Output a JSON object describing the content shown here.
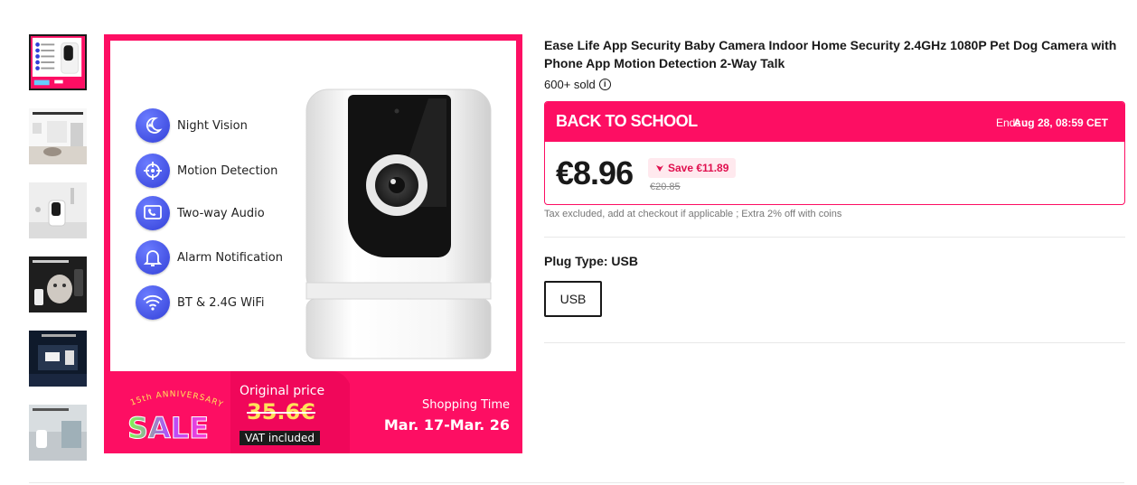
{
  "product": {
    "title": "Ease Life App Security Baby Camera Indoor Home Security 2.4GHz 1080P Pet Dog Camera with Phone App Motion Detection 2-Way Talk",
    "sold": "600+ sold",
    "info_icon": "info-icon"
  },
  "gallery": {
    "thumbnails": [
      {
        "name": "thumbnail-1",
        "active": true
      },
      {
        "name": "thumbnail-2",
        "active": false
      },
      {
        "name": "thumbnail-3",
        "active": false
      },
      {
        "name": "thumbnail-4",
        "active": false
      },
      {
        "name": "thumbnail-5",
        "active": false
      },
      {
        "name": "thumbnail-6",
        "active": false
      }
    ],
    "main_image": {
      "features": [
        {
          "label": "Night Vision",
          "icon": "moon-icon"
        },
        {
          "label": "Motion Detection",
          "icon": "motion-target-icon"
        },
        {
          "label": "Two-way Audio",
          "icon": "phone-call-icon"
        },
        {
          "label": "Alarm Notification",
          "icon": "bell-icon"
        },
        {
          "label": "BT & 2.4G WiFi",
          "icon": "wifi-icon"
        }
      ],
      "banner": {
        "anniversary": "15th ANNIVERSARY",
        "sale": "SALE",
        "original_price_label": "Original price",
        "original_price": "35.6€",
        "vat": "VAT included",
        "shopping_time_label": "Shopping Time",
        "shopping_dates": "Mar. 17-Mar. 26"
      }
    }
  },
  "deal": {
    "name": "BACK TO SCHOOL",
    "ends_label": "Ends :",
    "ends_value": "Aug 28, 08:59 CET",
    "price": "€8.96",
    "save": "Save €11.89",
    "old_price": "€20.85",
    "tax_note": "Tax excluded, add at checkout if applicable ; Extra 2% off with coins"
  },
  "options": {
    "plug_label": "Plug Type: USB",
    "plug_values": [
      "USB"
    ],
    "selected": "USB"
  },
  "colors": {
    "accent": "#fd0e63",
    "save_text": "#e0104f",
    "icon_blue": "#3340d8",
    "sale_yellow": "#ffe25a"
  }
}
